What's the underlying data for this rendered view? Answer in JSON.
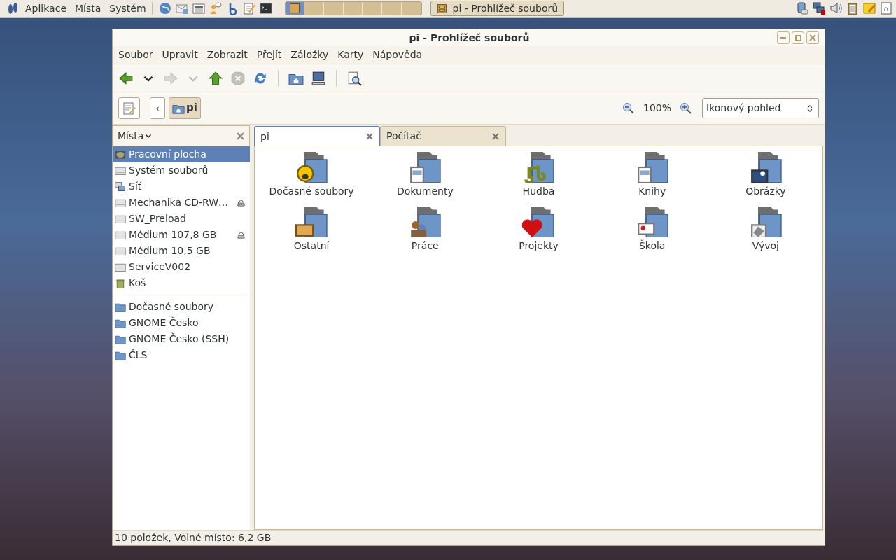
{
  "panel": {
    "menus": [
      "Aplikace",
      "Místa",
      "Systém"
    ],
    "workspaces": [
      {
        "selected": true
      },
      {
        "selected": false
      },
      {
        "selected": false
      },
      {
        "selected": false
      },
      {
        "selected": false
      },
      {
        "selected": false
      },
      {
        "selected": false
      }
    ],
    "task": {
      "label": "pi - Prohlížeč souborů",
      "selected": false
    }
  },
  "window": {
    "title": "pi - Prohlížeč souborů"
  },
  "menubar": [
    {
      "key": "S",
      "post": "oubor"
    },
    {
      "key": "U",
      "post": "pravit"
    },
    {
      "key": "Z",
      "post": "obrazit"
    },
    {
      "key": "P",
      "post": "řejít"
    },
    {
      "pre": "Zá",
      "key": "l",
      "post": "ožky"
    },
    {
      "pre": "Kar",
      "key": "t",
      "post": "y"
    },
    {
      "key": "N",
      "post": "ápověda"
    }
  ],
  "toolbar": [
    {
      "kind": "back",
      "disabled": false
    },
    {
      "kind": "drop",
      "disabled": false
    },
    {
      "kind": "forward",
      "disabled": true
    },
    {
      "kind": "drop",
      "disabled": true
    },
    {
      "kind": "up",
      "disabled": false
    },
    {
      "kind": "stop",
      "disabled": true
    },
    {
      "kind": "reload",
      "disabled": false
    },
    {
      "kind": "sep"
    },
    {
      "kind": "home",
      "disabled": false
    },
    {
      "kind": "computer",
      "disabled": false
    },
    {
      "kind": "sep"
    },
    {
      "kind": "search",
      "disabled": false
    }
  ],
  "location": {
    "back_label": "‹",
    "crumb": "pi",
    "zoom": "100%",
    "view": "Ikonový pohled"
  },
  "sidebar": {
    "title": "Místa",
    "places": [
      {
        "label": "Pracovní plocha",
        "kind": "desktop",
        "selected": true,
        "eject": false
      },
      {
        "label": "Systém souborů",
        "kind": "drive",
        "selected": false,
        "eject": false
      },
      {
        "label": "Síť",
        "kind": "network",
        "selected": false,
        "eject": false
      },
      {
        "label": "Mechanika CD-RW…",
        "kind": "drive",
        "selected": false,
        "eject": true
      },
      {
        "label": "SW_Preload",
        "kind": "drive",
        "selected": false,
        "eject": false
      },
      {
        "label": "Médium 107,8 GB",
        "kind": "drive",
        "selected": false,
        "eject": true
      },
      {
        "label": "Médium 10,5 GB",
        "kind": "drive",
        "selected": false,
        "eject": false
      },
      {
        "label": "ServiceV002",
        "kind": "drive",
        "selected": false,
        "eject": false
      },
      {
        "label": "Koš",
        "kind": "trash",
        "selected": false,
        "eject": false
      }
    ],
    "bookmarks": [
      {
        "label": "Dočasné soubory",
        "selected": false
      },
      {
        "label": "GNOME Česko",
        "selected": false
      },
      {
        "label": "GNOME Česko (SSH)",
        "selected": false
      },
      {
        "label": "ČLS",
        "selected": false
      }
    ]
  },
  "tabs": [
    {
      "label": "pi",
      "selected": true
    },
    {
      "label": "Počítač",
      "selected": false
    }
  ],
  "files": [
    {
      "name": "Dočasné soubory",
      "kind": "face"
    },
    {
      "name": "Dokumenty",
      "kind": "document"
    },
    {
      "name": "Hudba",
      "kind": "music"
    },
    {
      "name": "Knihy",
      "kind": "document"
    },
    {
      "name": "Obrázky",
      "kind": "picture"
    },
    {
      "name": "Ostatní",
      "kind": "box"
    },
    {
      "name": "Práce",
      "kind": "people"
    },
    {
      "name": "Projekty",
      "kind": "heart"
    },
    {
      "name": "Škola",
      "kind": "presentation"
    },
    {
      "name": "Vývoj",
      "kind": "diamond"
    }
  ],
  "status_bar": "10 položek, Volné místo: 6,2 GB"
}
